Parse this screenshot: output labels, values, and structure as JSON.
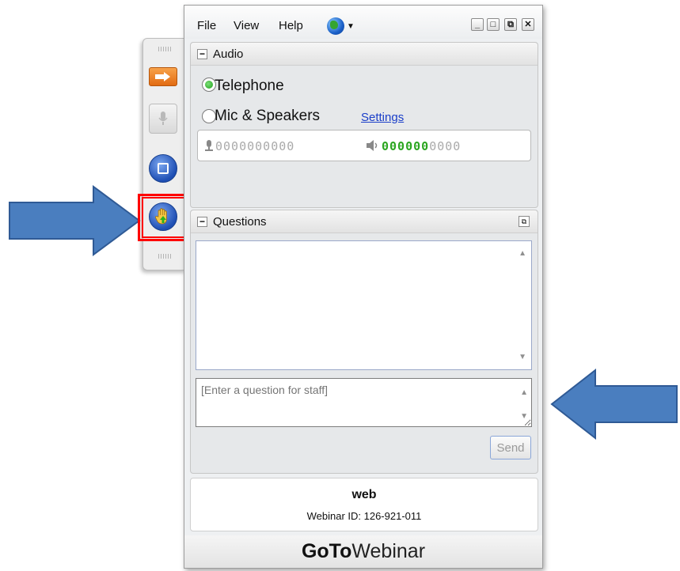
{
  "menubar": {
    "file": "File",
    "view": "View",
    "help": "Help"
  },
  "window_controls": {
    "minimize": "_",
    "maximize": "□",
    "restore": "⧉",
    "close": "✕"
  },
  "audio": {
    "title": "Audio",
    "collapse": "−",
    "options": [
      {
        "label": "Telephone",
        "selected": true
      },
      {
        "label": "Mic & Speakers",
        "selected": false
      }
    ],
    "settings_link": "Settings",
    "mic_meter": "0000000000",
    "speaker_meter_on": "000000",
    "speaker_meter_off": "0000"
  },
  "questions": {
    "title": "Questions",
    "collapse": "−",
    "input_placeholder": "[Enter a question for staff]",
    "send_label": "Send"
  },
  "info": {
    "webinar_name": "web",
    "webinar_id": "Webinar ID: 126-921-011"
  },
  "brand": {
    "goto": "GoTo",
    "webinar": "Webinar"
  },
  "colors": {
    "arrow_fill": "#4a7ebf",
    "highlight": "#ff0000",
    "link": "#1a3ec9",
    "meter_on": "#2aa51f"
  }
}
